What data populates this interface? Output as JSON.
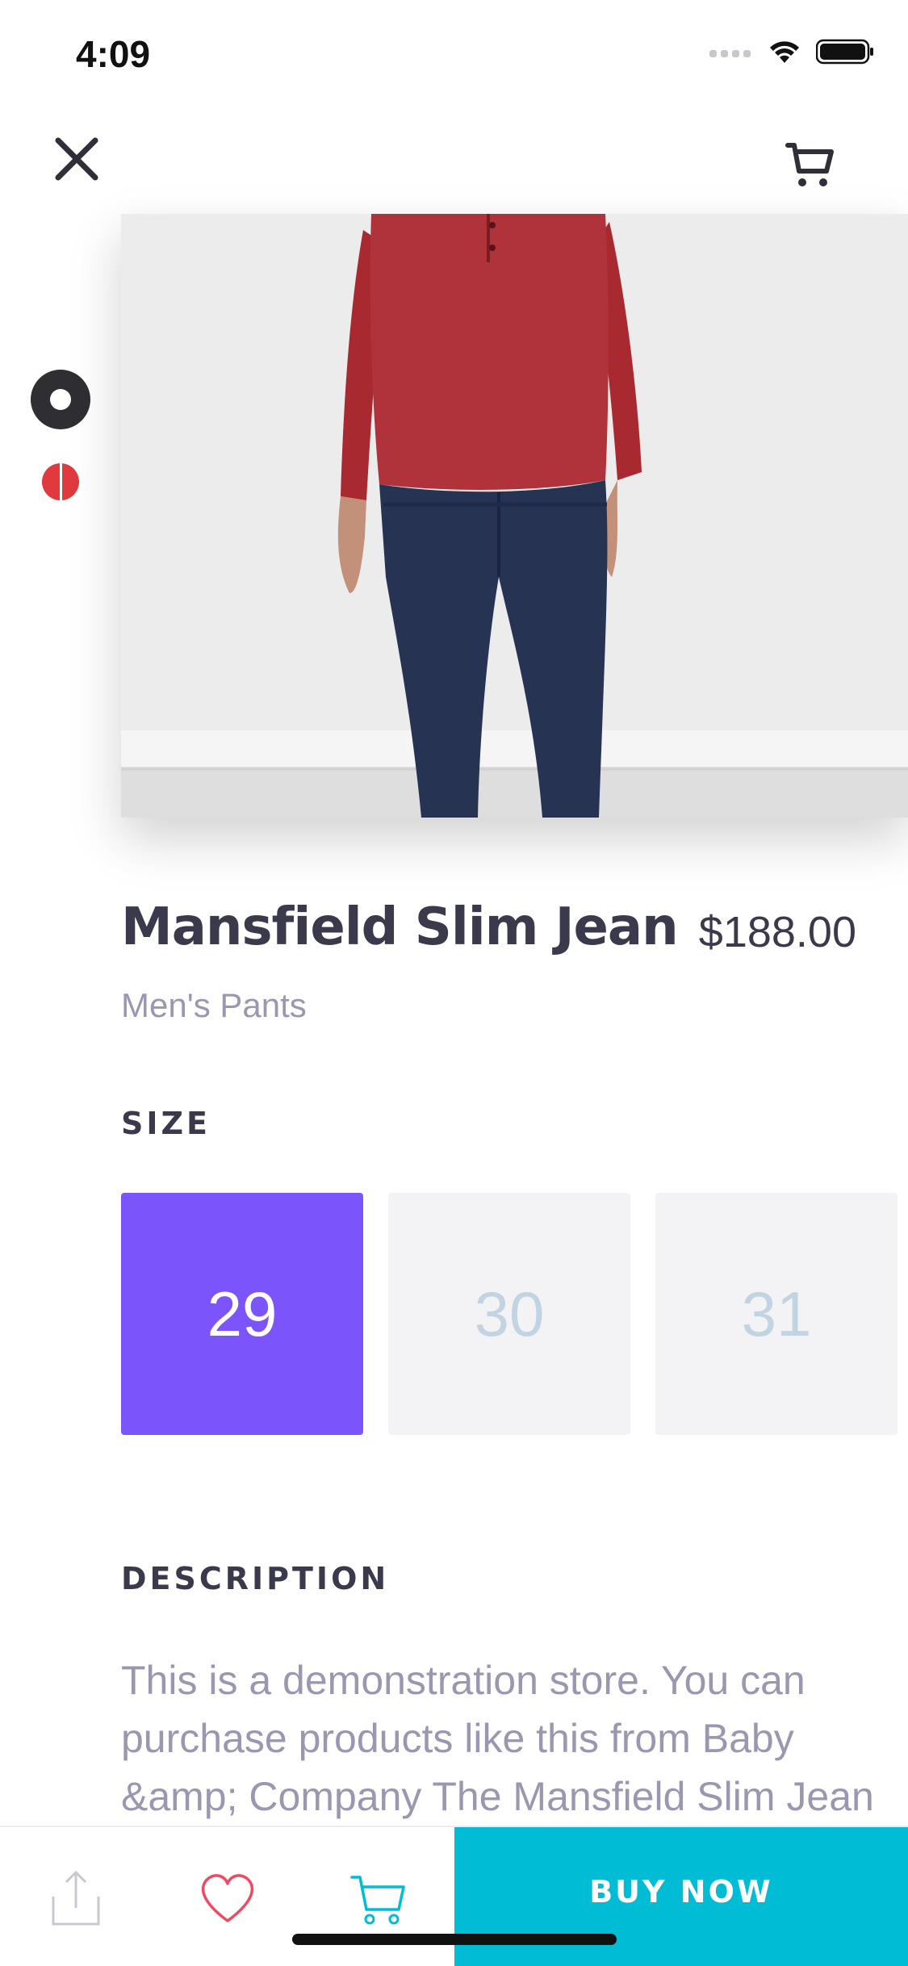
{
  "status_bar": {
    "time": "4:09"
  },
  "header": {
    "close_icon": "close-icon",
    "cart_icon": "cart-icon"
  },
  "colors": {
    "accent": "#7b55fb",
    "buy_now": "#00bcd4",
    "swatches": [
      "#2f2f33",
      "#e03a3e"
    ]
  },
  "product": {
    "title": "Mansfield Slim Jean",
    "price": "$188.00",
    "category": "Men's Pants"
  },
  "size": {
    "label": "SIZE",
    "options": [
      "29",
      "30",
      "31"
    ],
    "selected": "29"
  },
  "description": {
    "label": "DESCRIPTION",
    "text": "This is a demonstration store. You can purchase products like this from Baby &amp; Company The Mansfield Slim Jean by US"
  },
  "actions": {
    "share_icon": "share-icon",
    "wishlist_icon": "heart-icon",
    "cart_icon": "cart-icon",
    "buy_now": "BUY NOW"
  }
}
